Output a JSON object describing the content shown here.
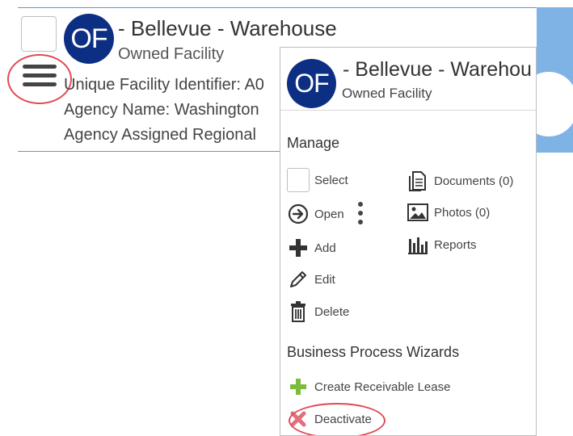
{
  "record": {
    "avatar_initials": "OF",
    "title": "- Bellevue - Warehouse",
    "subtitle": "Owned Facility",
    "details": [
      "Unique Facility Identifier: A0",
      "Agency Name: Washington",
      "Agency Assigned Regional"
    ]
  },
  "menu": {
    "avatar_initials": "OF",
    "title": "- Bellevue - Warehou",
    "subtitle": "Owned Facility",
    "manage_heading": "Manage",
    "manage_left": [
      {
        "label": "Select",
        "icon": "checkbox-icon"
      },
      {
        "label": "Open",
        "icon": "arrow-circle-right-icon"
      },
      {
        "label": "Add",
        "icon": "plus-icon"
      },
      {
        "label": "Edit",
        "icon": "pencil-icon"
      },
      {
        "label": "Delete",
        "icon": "trash-icon"
      }
    ],
    "manage_right": [
      {
        "label": "Documents (0)",
        "icon": "documents-icon"
      },
      {
        "label": "Photos (0)",
        "icon": "photo-icon"
      },
      {
        "label": "Reports",
        "icon": "bar-chart-icon"
      }
    ],
    "wizards_heading": "Business Process Wizards",
    "wizards": [
      {
        "label": "Create Receivable Lease",
        "icon": "green-plus-icon"
      },
      {
        "label": "Deactivate",
        "icon": "red-x-icon"
      }
    ]
  },
  "colors": {
    "avatar_bg": "#0d2f83",
    "accent_line": "#5b9bd5",
    "annotation": "#e14a55",
    "wizard_plus": "#7cbb3c",
    "wizard_x": "#e0707b"
  }
}
